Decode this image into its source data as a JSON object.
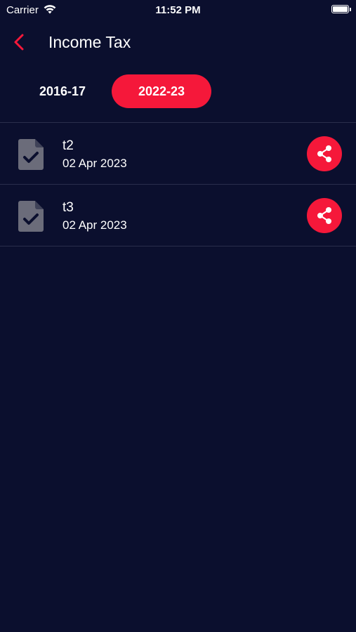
{
  "status_bar": {
    "carrier": "Carrier",
    "time": "11:52 PM",
    "battery_level": 1.0
  },
  "header": {
    "title": "Income Tax",
    "back_icon": "chevron-left-icon"
  },
  "tabs": [
    {
      "label": "2016-17",
      "active": false
    },
    {
      "label": "2022-23",
      "active": true
    }
  ],
  "documents": [
    {
      "name": "t2",
      "date": "02 Apr 2023",
      "icon": "document-check-icon",
      "action_icon": "share-icon"
    },
    {
      "name": "t3",
      "date": "02 Apr 2023",
      "icon": "document-check-icon",
      "action_icon": "share-icon"
    }
  ],
  "colors": {
    "background": "#0b0f2e",
    "accent": "#f5183a",
    "divider": "#2a2e4c",
    "doc_icon": "#6b6c7a",
    "text": "#ffffff"
  }
}
